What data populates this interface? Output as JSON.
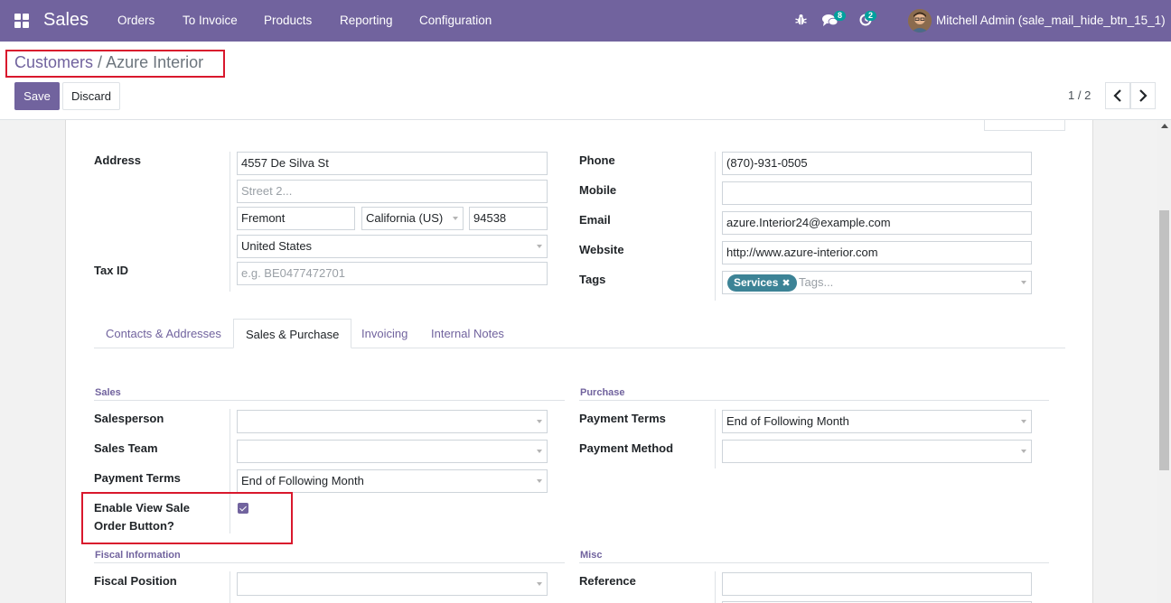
{
  "navbar": {
    "brand": "Sales",
    "menu": [
      "Orders",
      "To Invoice",
      "Products",
      "Reporting",
      "Configuration"
    ],
    "messages_count": "8",
    "activities_count": "2",
    "user_name": "Mitchell Admin (sale_mail_hide_btn_15_1)"
  },
  "breadcrumb": {
    "parent": "Customers",
    "separator": "/",
    "current": "Azure Interior"
  },
  "actions": {
    "save": "Save",
    "discard": "Discard"
  },
  "pager": {
    "value": "1 / 2"
  },
  "address": {
    "label": "Address",
    "street": "4557 De Silva St",
    "street2_placeholder": "Street 2...",
    "city": "Fremont",
    "state": "California (US)",
    "zip": "94538",
    "country": "United States"
  },
  "tax": {
    "label": "Tax ID",
    "placeholder": "e.g. BE0477472701"
  },
  "contact": {
    "phone_label": "Phone",
    "phone": "(870)-931-0505",
    "mobile_label": "Mobile",
    "mobile": "",
    "email_label": "Email",
    "email": "azure.Interior24@example.com",
    "website_label": "Website",
    "website": "http://www.azure-interior.com",
    "tags_label": "Tags",
    "tag": "Services",
    "tags_placeholder": "Tags..."
  },
  "tabs": [
    "Contacts & Addresses",
    "Sales & Purchase",
    "Invoicing",
    "Internal Notes"
  ],
  "sales": {
    "title": "Sales",
    "salesperson_label": "Salesperson",
    "sales_team_label": "Sales Team",
    "payment_terms_label": "Payment Terms",
    "payment_terms": "End of Following Month",
    "enable_view_label_1": "Enable View Sale",
    "enable_view_label_2": "Order Button?",
    "enable_view_checked": true
  },
  "purchase": {
    "title": "Purchase",
    "payment_terms_label": "Payment Terms",
    "payment_terms": "End of Following Month",
    "payment_method_label": "Payment Method"
  },
  "fiscal": {
    "title": "Fiscal Information",
    "position_label": "Fiscal Position"
  },
  "misc": {
    "title": "Misc",
    "reference_label": "Reference"
  },
  "colors": {
    "primary": "#71639e",
    "tag": "#3c8396",
    "badge": "#00a09d",
    "highlight": "#d9182d"
  }
}
